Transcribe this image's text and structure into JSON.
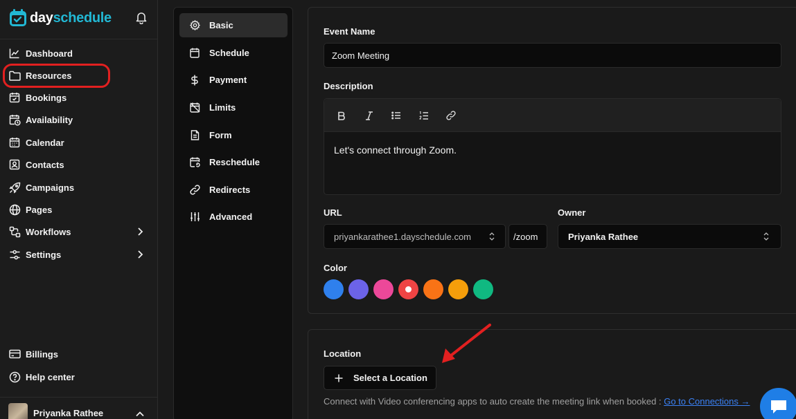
{
  "brand": {
    "name_part1": "day",
    "name_part2": "schedule"
  },
  "sidebar": {
    "items": [
      {
        "label": "Dashboard",
        "icon": "chart-line-icon"
      },
      {
        "label": "Resources",
        "icon": "folder-icon"
      },
      {
        "label": "Bookings",
        "icon": "calendar-check-icon"
      },
      {
        "label": "Availability",
        "icon": "calendar-clock-icon"
      },
      {
        "label": "Calendar",
        "icon": "calendar-icon"
      },
      {
        "label": "Contacts",
        "icon": "contact-card-icon"
      },
      {
        "label": "Campaigns",
        "icon": "rocket-icon"
      },
      {
        "label": "Pages",
        "icon": "globe-icon"
      },
      {
        "label": "Workflows",
        "icon": "workflow-icon"
      },
      {
        "label": "Settings",
        "icon": "sliders-icon"
      }
    ],
    "bottom_items": [
      {
        "label": "Billings",
        "icon": "credit-card-icon"
      },
      {
        "label": "Help center",
        "icon": "help-circle-icon"
      }
    ],
    "user": {
      "name": "Priyanka Rathee"
    },
    "highlight_color": "#e22020"
  },
  "tabs": [
    {
      "label": "Basic",
      "icon": "gear-icon",
      "active": true
    },
    {
      "label": "Schedule",
      "icon": "calendar-icon"
    },
    {
      "label": "Payment",
      "icon": "dollar-icon"
    },
    {
      "label": "Limits",
      "icon": "calendar-off-icon"
    },
    {
      "label": "Form",
      "icon": "document-icon"
    },
    {
      "label": "Reschedule",
      "icon": "calendar-repeat-icon"
    },
    {
      "label": "Redirects",
      "icon": "link-icon"
    },
    {
      "label": "Advanced",
      "icon": "sliders-vertical-icon"
    }
  ],
  "form": {
    "event_name_label": "Event Name",
    "event_name_value": "Zoom Meeting",
    "description_label": "Description",
    "description_value": "Let's connect through Zoom.",
    "toolbar": [
      "bold-icon",
      "italic-icon",
      "bullet-list-icon",
      "numbered-list-icon",
      "link-icon"
    ],
    "url_label": "URL",
    "url_domain": "priyankarathee1.dayschedule.com",
    "url_slug": "/zoom",
    "owner_label": "Owner",
    "owner_value": "Priyanka Rathee",
    "color_label": "Color",
    "colors": [
      "#2f80ed",
      "#6c63e8",
      "#ec4899",
      "#ef4444",
      "#f97316",
      "#f59e0b",
      "#10b981"
    ],
    "selected_color_index": 3
  },
  "location": {
    "label": "Location",
    "button_label": "Select a Location",
    "help_text": "Connect with Video conferencing apps to auto create the meeting link when booked :",
    "help_link": "Go to Connections →"
  },
  "accent_color": "#22b8d4",
  "annotation_arrow_color": "#e22020"
}
